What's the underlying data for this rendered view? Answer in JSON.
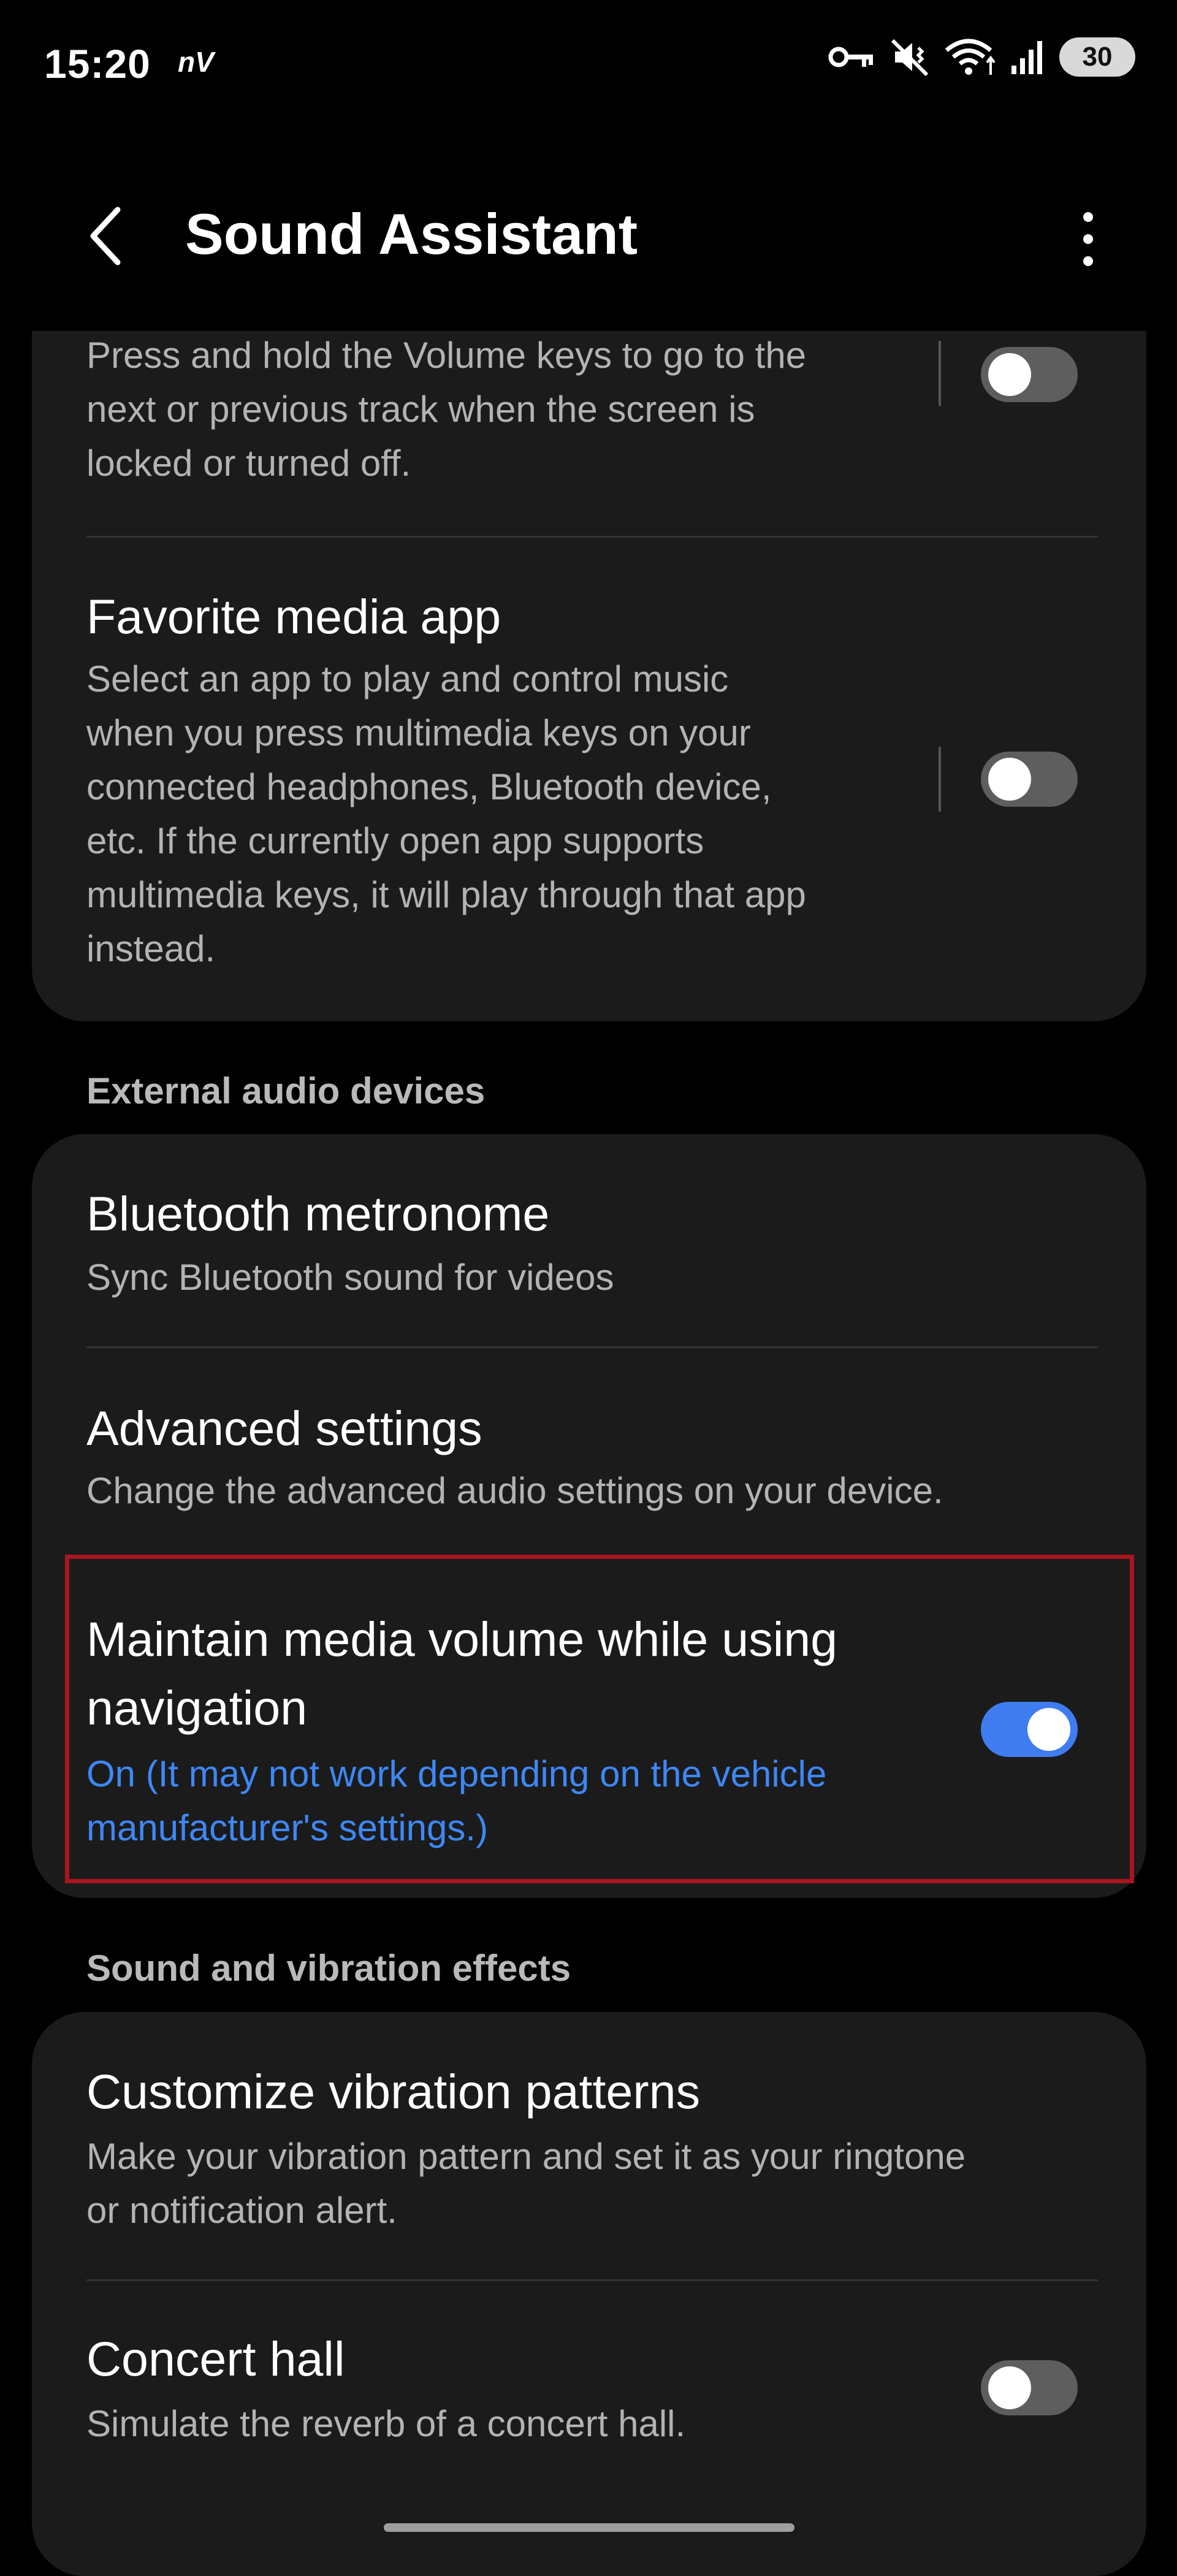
{
  "status_bar": {
    "time": "15:20",
    "carrier_badge": "nV",
    "battery": "30",
    "icons": [
      "key-icon",
      "mute-vibrate-icon",
      "wifi-icon",
      "signal-icon",
      "battery-icon"
    ]
  },
  "header": {
    "title": "Sound Assistant",
    "back_icon": "chevron-left-icon",
    "more_icon": "more-vertical-icon"
  },
  "card1": {
    "item1": {
      "desc_lines": [
        "Press and hold the Volume keys to go to the",
        "next or previous track when the screen is",
        "locked or turned off."
      ],
      "toggle": false
    },
    "item2": {
      "title": "Favorite media app",
      "desc_lines": [
        "Select an app to play and control music",
        "when you press multimedia keys on your",
        "connected headphones, Bluetooth device,",
        "etc. If the currently open app supports",
        "multimedia keys, it will play through that app",
        "instead."
      ],
      "toggle": false
    }
  },
  "section_external": "External audio devices",
  "card2": {
    "bluetooth": {
      "title": "Bluetooth metronome",
      "desc": "Sync Bluetooth sound for videos"
    },
    "advanced": {
      "title": "Advanced settings",
      "desc": "Change the advanced audio settings on your device."
    },
    "maintain": {
      "title_lines": [
        "Maintain media volume while using",
        "navigation"
      ],
      "status_lines": [
        "On (It may not work depending on the vehicle",
        "manufacturer's settings.)"
      ],
      "toggle": true
    }
  },
  "section_effects": "Sound and vibration effects",
  "card3": {
    "vibration": {
      "title": "Customize vibration patterns",
      "desc_lines": [
        "Make your vibration pattern and set it as your ringtone",
        "or notification alert."
      ]
    },
    "concert": {
      "title": "Concert hall",
      "desc": "Simulate the reverb of a concert hall.",
      "toggle": false
    }
  },
  "colors": {
    "background": "#000000",
    "card": "#1b1b1b",
    "accent": "#3e7cf0",
    "highlight_border": "#a8161f"
  }
}
